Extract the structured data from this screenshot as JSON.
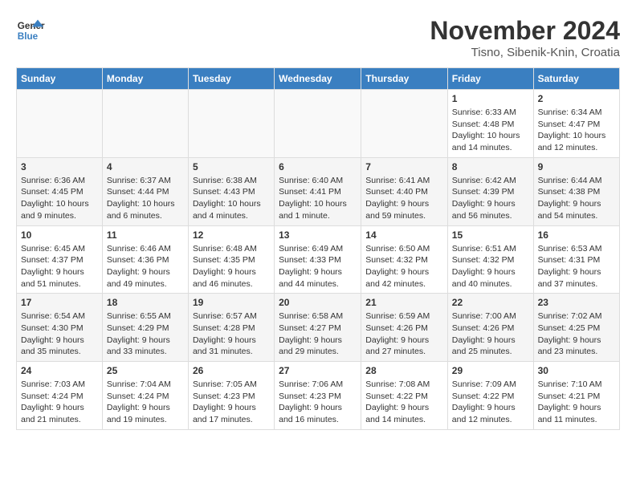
{
  "header": {
    "logo_line1": "General",
    "logo_line2": "Blue",
    "month": "November 2024",
    "location": "Tisno, Sibenik-Knin, Croatia"
  },
  "weekdays": [
    "Sunday",
    "Monday",
    "Tuesday",
    "Wednesday",
    "Thursday",
    "Friday",
    "Saturday"
  ],
  "weeks": [
    [
      {
        "day": "",
        "info": ""
      },
      {
        "day": "",
        "info": ""
      },
      {
        "day": "",
        "info": ""
      },
      {
        "day": "",
        "info": ""
      },
      {
        "day": "",
        "info": ""
      },
      {
        "day": "1",
        "info": "Sunrise: 6:33 AM\nSunset: 4:48 PM\nDaylight: 10 hours and 14 minutes."
      },
      {
        "day": "2",
        "info": "Sunrise: 6:34 AM\nSunset: 4:47 PM\nDaylight: 10 hours and 12 minutes."
      }
    ],
    [
      {
        "day": "3",
        "info": "Sunrise: 6:36 AM\nSunset: 4:45 PM\nDaylight: 10 hours and 9 minutes."
      },
      {
        "day": "4",
        "info": "Sunrise: 6:37 AM\nSunset: 4:44 PM\nDaylight: 10 hours and 6 minutes."
      },
      {
        "day": "5",
        "info": "Sunrise: 6:38 AM\nSunset: 4:43 PM\nDaylight: 10 hours and 4 minutes."
      },
      {
        "day": "6",
        "info": "Sunrise: 6:40 AM\nSunset: 4:41 PM\nDaylight: 10 hours and 1 minute."
      },
      {
        "day": "7",
        "info": "Sunrise: 6:41 AM\nSunset: 4:40 PM\nDaylight: 9 hours and 59 minutes."
      },
      {
        "day": "8",
        "info": "Sunrise: 6:42 AM\nSunset: 4:39 PM\nDaylight: 9 hours and 56 minutes."
      },
      {
        "day": "9",
        "info": "Sunrise: 6:44 AM\nSunset: 4:38 PM\nDaylight: 9 hours and 54 minutes."
      }
    ],
    [
      {
        "day": "10",
        "info": "Sunrise: 6:45 AM\nSunset: 4:37 PM\nDaylight: 9 hours and 51 minutes."
      },
      {
        "day": "11",
        "info": "Sunrise: 6:46 AM\nSunset: 4:36 PM\nDaylight: 9 hours and 49 minutes."
      },
      {
        "day": "12",
        "info": "Sunrise: 6:48 AM\nSunset: 4:35 PM\nDaylight: 9 hours and 46 minutes."
      },
      {
        "day": "13",
        "info": "Sunrise: 6:49 AM\nSunset: 4:33 PM\nDaylight: 9 hours and 44 minutes."
      },
      {
        "day": "14",
        "info": "Sunrise: 6:50 AM\nSunset: 4:32 PM\nDaylight: 9 hours and 42 minutes."
      },
      {
        "day": "15",
        "info": "Sunrise: 6:51 AM\nSunset: 4:32 PM\nDaylight: 9 hours and 40 minutes."
      },
      {
        "day": "16",
        "info": "Sunrise: 6:53 AM\nSunset: 4:31 PM\nDaylight: 9 hours and 37 minutes."
      }
    ],
    [
      {
        "day": "17",
        "info": "Sunrise: 6:54 AM\nSunset: 4:30 PM\nDaylight: 9 hours and 35 minutes."
      },
      {
        "day": "18",
        "info": "Sunrise: 6:55 AM\nSunset: 4:29 PM\nDaylight: 9 hours and 33 minutes."
      },
      {
        "day": "19",
        "info": "Sunrise: 6:57 AM\nSunset: 4:28 PM\nDaylight: 9 hours and 31 minutes."
      },
      {
        "day": "20",
        "info": "Sunrise: 6:58 AM\nSunset: 4:27 PM\nDaylight: 9 hours and 29 minutes."
      },
      {
        "day": "21",
        "info": "Sunrise: 6:59 AM\nSunset: 4:26 PM\nDaylight: 9 hours and 27 minutes."
      },
      {
        "day": "22",
        "info": "Sunrise: 7:00 AM\nSunset: 4:26 PM\nDaylight: 9 hours and 25 minutes."
      },
      {
        "day": "23",
        "info": "Sunrise: 7:02 AM\nSunset: 4:25 PM\nDaylight: 9 hours and 23 minutes."
      }
    ],
    [
      {
        "day": "24",
        "info": "Sunrise: 7:03 AM\nSunset: 4:24 PM\nDaylight: 9 hours and 21 minutes."
      },
      {
        "day": "25",
        "info": "Sunrise: 7:04 AM\nSunset: 4:24 PM\nDaylight: 9 hours and 19 minutes."
      },
      {
        "day": "26",
        "info": "Sunrise: 7:05 AM\nSunset: 4:23 PM\nDaylight: 9 hours and 17 minutes."
      },
      {
        "day": "27",
        "info": "Sunrise: 7:06 AM\nSunset: 4:23 PM\nDaylight: 9 hours and 16 minutes."
      },
      {
        "day": "28",
        "info": "Sunrise: 7:08 AM\nSunset: 4:22 PM\nDaylight: 9 hours and 14 minutes."
      },
      {
        "day": "29",
        "info": "Sunrise: 7:09 AM\nSunset: 4:22 PM\nDaylight: 9 hours and 12 minutes."
      },
      {
        "day": "30",
        "info": "Sunrise: 7:10 AM\nSunset: 4:21 PM\nDaylight: 9 hours and 11 minutes."
      }
    ]
  ]
}
